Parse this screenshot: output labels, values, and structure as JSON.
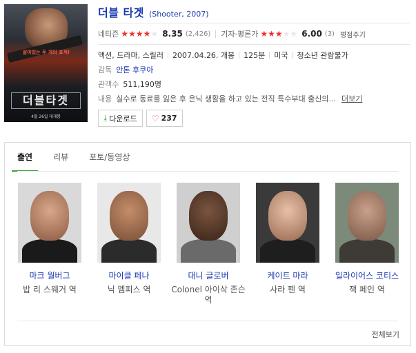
{
  "movie": {
    "title": "더블 타겟",
    "subtitle": "(Shooter, 2007)",
    "poster": {
      "title_text": "더블타겟",
      "tagline": "살아있는 두 개의 표적!",
      "release_text": "4월 26일 대개봉"
    },
    "ratings": {
      "netizen_label": "네티즌",
      "netizen_score": "8.35",
      "netizen_count": "(2,426)",
      "netizen_stars": 4,
      "critic_label": "기자·평론가",
      "critic_score": "6.00",
      "critic_count": "(3)",
      "critic_stars": 3,
      "write_label": "평점주기"
    },
    "genre": "액션, 드라마, 스릴러",
    "release": "2007.04.26. 개봉",
    "runtime": "125분",
    "country": "미국",
    "age_rating": "청소년 관람불가",
    "director_label": "감독",
    "director": "안톤 후쿠아",
    "audience_label": "관객수",
    "audience": "511,190명",
    "summary_label": "내용",
    "summary": "실수로 동료를 잃은 후 은닉 생활을 하고 있는 전직 특수부대 출신의...",
    "more_label": "더보기",
    "download_label": "다운로드",
    "likes": "237"
  },
  "tabs": [
    {
      "label": "출연"
    },
    {
      "label": "리뷰"
    },
    {
      "label": "포토/동영상"
    }
  ],
  "cast": [
    {
      "name": "마크 월버그",
      "role": "밥 리 스웨거 역"
    },
    {
      "name": "마이클 페나",
      "role": "닉 멤피스 역"
    },
    {
      "name": "대니 글로버",
      "role": "Colonel 아이삭 존슨 역"
    },
    {
      "name": "케이트 마라",
      "role": "사라 펜 역"
    },
    {
      "name": "일라이어스 코티스",
      "role": "잭 페인 역"
    }
  ],
  "view_all_label": "전체보기",
  "colors": {
    "link": "#1a3ab1",
    "star_on": "#ee3030",
    "tab_accent": "#3aa037"
  }
}
